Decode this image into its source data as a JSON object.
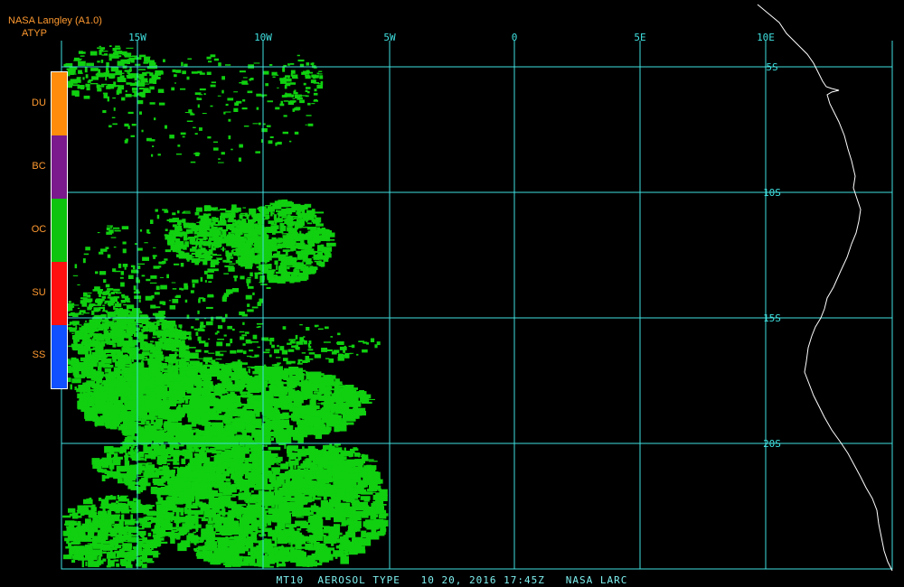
{
  "header": {
    "title": "NASA Langley (A1.0)",
    "product": "ATYP"
  },
  "legend": {
    "items": [
      {
        "code": "DU",
        "color": "#ff8c0a"
      },
      {
        "code": "BC",
        "color": "#7a1a8c"
      },
      {
        "code": "OC",
        "color": "#0ec40e"
      },
      {
        "code": "SU",
        "color": "#ff1010"
      },
      {
        "code": "SS",
        "color": "#1050ff"
      }
    ]
  },
  "grid": {
    "lon_labels": [
      "15W",
      "10W",
      "5W",
      "0",
      "5E",
      "10E"
    ],
    "lat_labels": [
      "5S",
      "10S",
      "15S",
      "20S"
    ],
    "line_color": "#40e0e0"
  },
  "colors": {
    "aerosol_fill": "#10d010",
    "coastline": "#ffffff",
    "background": "#000000"
  },
  "footer": {
    "text": "MT10  AEROSOL TYPE   10 20, 2016 17:45Z   NASA LARC"
  }
}
